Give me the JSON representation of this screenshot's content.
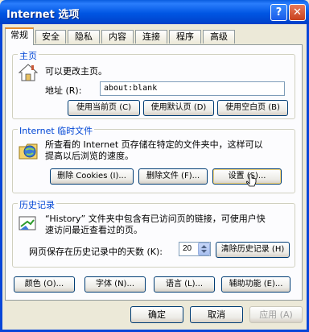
{
  "window": {
    "title": "Internet 选项",
    "help": "?",
    "close": "✕"
  },
  "tabs": [
    "常规",
    "安全",
    "隐私",
    "内容",
    "连接",
    "程序",
    "高级"
  ],
  "homepage": {
    "group_label": "主页",
    "desc": "可以更改主页。",
    "address_label": "地址 (R):",
    "address_value": "about:blank",
    "buttons": [
      "使用当前页 (C)",
      "使用默认页 (D)",
      "使用空白页 (B)"
    ]
  },
  "temp_files": {
    "group_label": "Internet 临时文件",
    "desc_line1": "所查看的 Internet 页存储在特定的文件夹中，这样可以",
    "desc_line2": "提高以后浏览的速度。",
    "buttons": [
      "删除 Cookies (I)...",
      "删除文件 (F)...",
      "设置 (S)..."
    ]
  },
  "history": {
    "group_label": "历史记录",
    "desc_line1": "“History” 文件夹中包含有已访问页的链接，可使用户快",
    "desc_line2": "速访问最近查看过的页。",
    "days_label": "网页保存在历史记录中的天数 (K):",
    "days_value": "20",
    "clear_button": "清除历史记录 (H)"
  },
  "bottom_buttons": [
    "颜色 (O)...",
    "字体 (N)...",
    "语言 (L)...",
    "辅助功能 (E)..."
  ],
  "dialog_buttons": {
    "ok": "确定",
    "cancel": "取消",
    "apply": "应用 (A)"
  }
}
